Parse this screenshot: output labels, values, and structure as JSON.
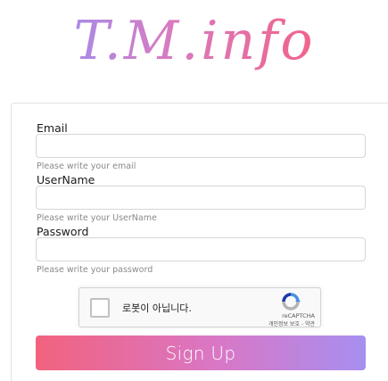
{
  "logo": {
    "text": "T.M.info"
  },
  "form": {
    "email": {
      "label": "Email",
      "value": "",
      "placeholder": "",
      "help": "Please write your email"
    },
    "username": {
      "label": "UserName",
      "value": "",
      "placeholder": "",
      "help": "Please write your UserName"
    },
    "password": {
      "label": "Password",
      "value": "",
      "placeholder": "",
      "help": "Please write your password"
    }
  },
  "recaptcha": {
    "label": "로봇이 아닙니다.",
    "brand": "reCAPTCHA",
    "terms": "개인정보 보호 - 약관",
    "icon": "recaptcha-logo-icon"
  },
  "signup": {
    "label": "Sign Up"
  },
  "colors": {
    "gradient_start": "#f2627d",
    "gradient_mid": "#d977c6",
    "gradient_end": "#a78ff0",
    "recaptcha_blue": "#4a90e2",
    "recaptcha_gray": "#b4b4b4"
  }
}
